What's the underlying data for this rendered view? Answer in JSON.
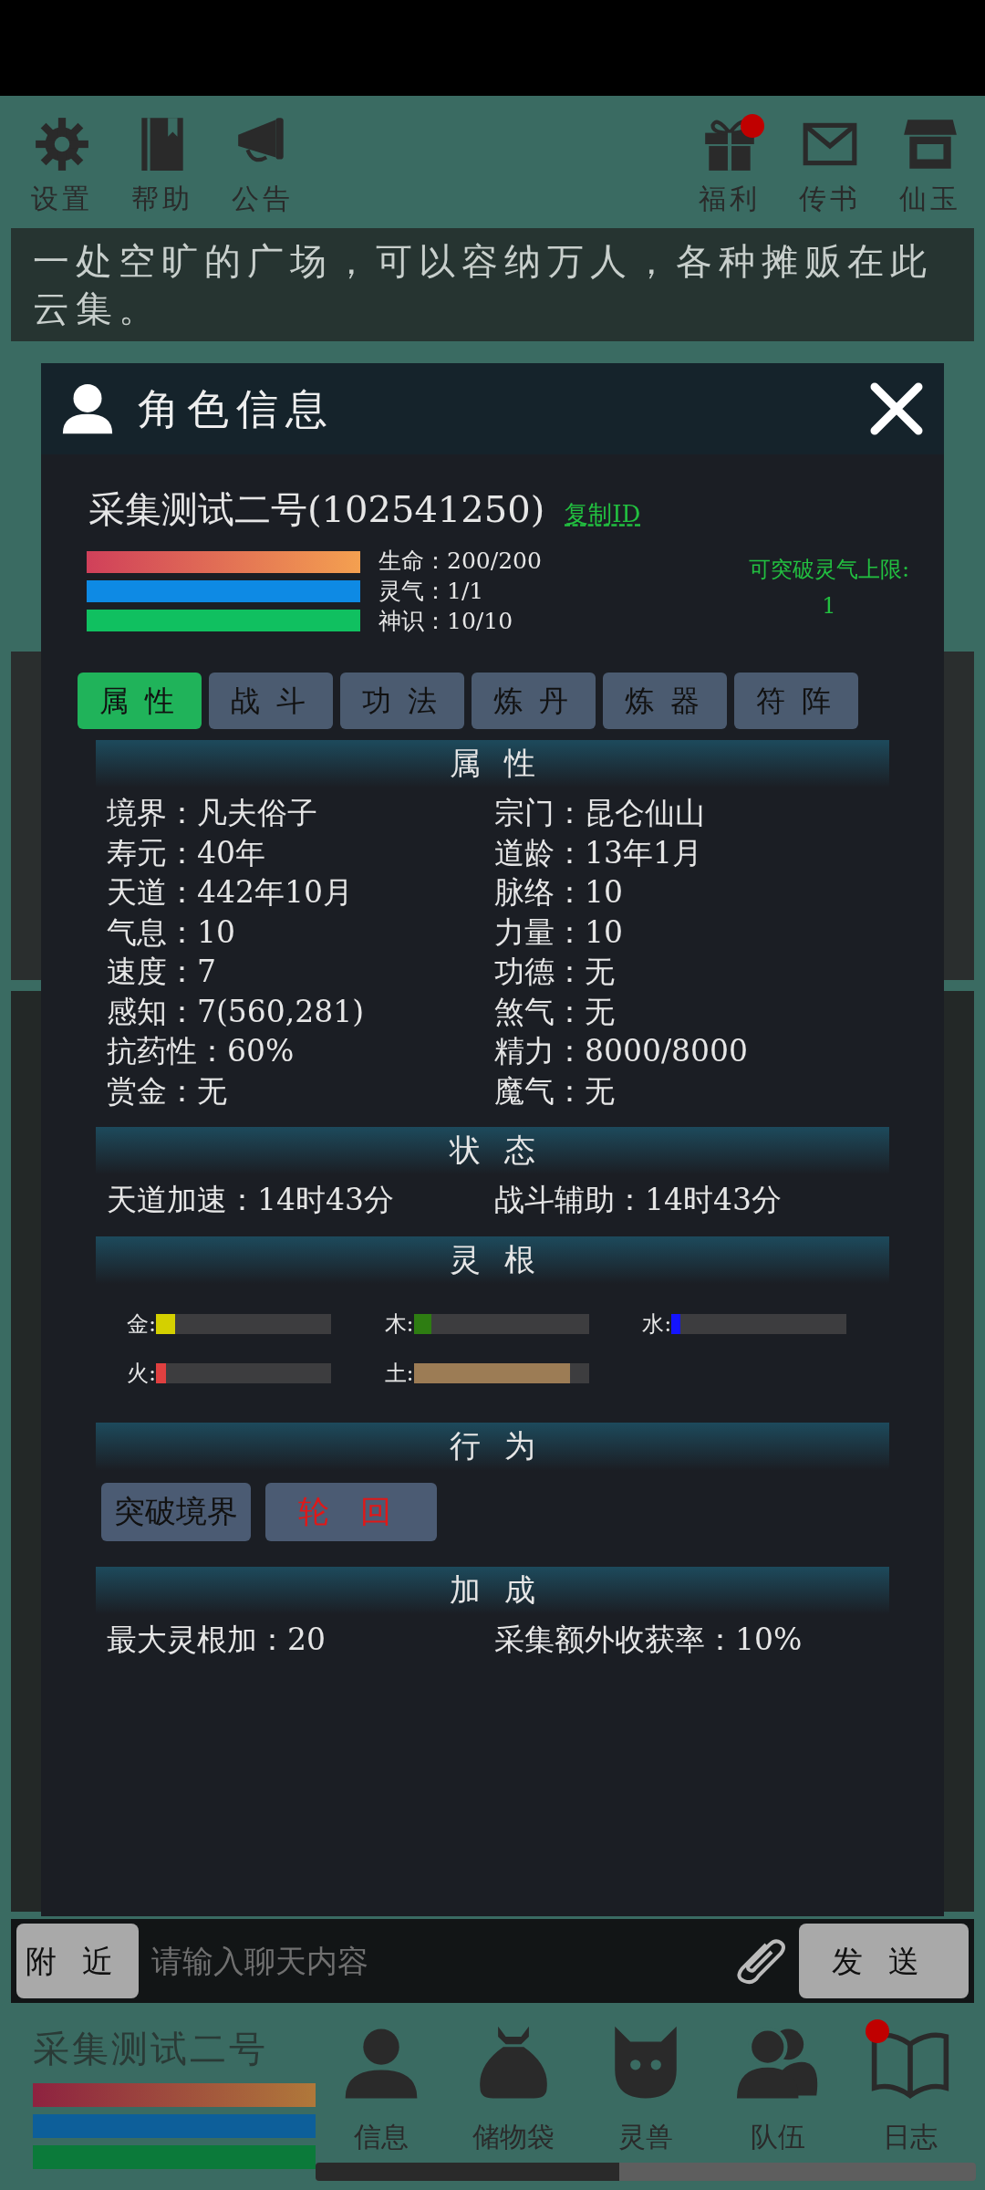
{
  "top_bar": {
    "left": [
      {
        "label": "设置",
        "badge": false
      },
      {
        "label": "帮助",
        "badge": false
      },
      {
        "label": "公告",
        "badge": false
      }
    ],
    "right": [
      {
        "label": "福利",
        "badge": true
      },
      {
        "label": "传书",
        "badge": false
      },
      {
        "label": "仙玉",
        "badge": false
      }
    ]
  },
  "description": "一处空旷的广场，可以容纳万人，各种摊贩在此云集。",
  "dialog": {
    "title": "角色信息",
    "name": "采集测试二号(102541250)",
    "copy_id": "复制ID",
    "stats": [
      {
        "kind": "hp",
        "label": "生命：200/200",
        "level": 1
      },
      {
        "kind": "qi",
        "label": "灵气：1/1",
        "level": 1
      },
      {
        "kind": "sense",
        "label": "神识：10/10",
        "level": 1
      }
    ],
    "breakthrough": {
      "label": "可突破灵气上限:",
      "value": "1"
    },
    "tabs": [
      {
        "label": "属性",
        "selected": true
      },
      {
        "label": "战斗",
        "selected": false
      },
      {
        "label": "功法",
        "selected": false
      },
      {
        "label": "炼丹",
        "selected": false
      },
      {
        "label": "炼器",
        "selected": false
      },
      {
        "label": "符阵",
        "selected": false
      }
    ],
    "sections": [
      {
        "title": "属性",
        "kind": "pairs",
        "items": [
          "境界：凡夫俗子",
          "宗门：昆仑仙山",
          "寿元：40年",
          "道龄：13年1月",
          "天道：442年10月",
          "脉络：10",
          "气息：10",
          "力量：10",
          "速度：7",
          "功德：无",
          "感知：7(560,281)",
          "煞气：无",
          "抗药性：60%",
          "精力：8000/8000",
          "赏金：无",
          "魔气：无"
        ]
      },
      {
        "title": "状态",
        "kind": "pairs",
        "items": [
          "天道加速：14时43分",
          "战斗辅助：14时43分"
        ]
      },
      {
        "title": "灵根",
        "kind": "roots",
        "items": [
          {
            "label": "金:",
            "level": 0.11,
            "color": "#d4d000"
          },
          {
            "label": "木:",
            "level": 0.1,
            "color": "#2e7d12"
          },
          {
            "label": "水:",
            "level": 0.05,
            "color": "#1414ff"
          },
          {
            "label": "火:",
            "level": 0.055,
            "color": "#e04040"
          },
          {
            "label": "土:",
            "level": 0.89,
            "color": "#9c7c55"
          }
        ]
      },
      {
        "title": "行为",
        "kind": "buttons",
        "items": [
          {
            "label": "突破境界",
            "danger": false
          },
          {
            "label": "轮回",
            "danger": true
          }
        ]
      },
      {
        "title": "加成",
        "kind": "pairs",
        "items": [
          "最大灵根加：20",
          "采集额外收获率：10%"
        ]
      }
    ]
  },
  "chat": {
    "channel": "附近",
    "placeholder": "请输入聊天内容",
    "send": "发送"
  },
  "player": {
    "name": "采集测试二号",
    "bars": [
      {
        "kind": "hp",
        "level": 1
      },
      {
        "kind": "qi",
        "level": 1
      },
      {
        "kind": "sense",
        "level": 1
      }
    ]
  },
  "nav": [
    {
      "label": "信息",
      "badge": false
    },
    {
      "label": "储物袋",
      "badge": false
    },
    {
      "label": "灵兽",
      "badge": false
    },
    {
      "label": "队伍",
      "badge": false
    },
    {
      "label": "日志",
      "badge": true
    }
  ],
  "progress": {
    "level": 0.46
  }
}
